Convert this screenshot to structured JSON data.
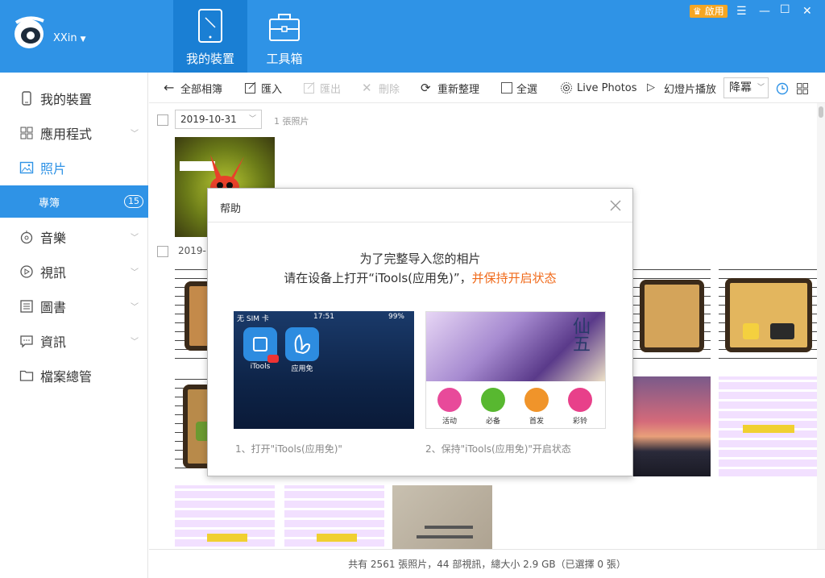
{
  "app": {
    "user": "XXin",
    "vip_label": "啟用"
  },
  "nav_tabs": [
    {
      "label": "我的裝置"
    },
    {
      "label": "工具箱"
    }
  ],
  "sidebar": {
    "items": [
      {
        "label": "我的裝置",
        "icon": "phone-icon"
      },
      {
        "label": "應用程式",
        "icon": "apps-icon"
      },
      {
        "label": "照片",
        "icon": "photo-icon"
      },
      {
        "label": "音樂",
        "icon": "music-icon"
      },
      {
        "label": "視訊",
        "icon": "video-icon"
      },
      {
        "label": "圖書",
        "icon": "book-icon"
      },
      {
        "label": "資訊",
        "icon": "message-icon"
      },
      {
        "label": "檔案總管",
        "icon": "folder-icon"
      }
    ],
    "sub_item": {
      "label": "專簿",
      "badge": "15"
    }
  },
  "toolbar": {
    "all_albums": "全部相簿",
    "import": "匯入",
    "export": "匯出",
    "delete": "刪除",
    "reorganize": "重新整理",
    "select_all": "全選",
    "live_photos": "Live Photos",
    "slideshow": "幻燈片播放",
    "sort": "降冪"
  },
  "groups": [
    {
      "date": "2019-10-31",
      "count": "1 張照片"
    },
    {
      "date": "2019-1"
    }
  ],
  "status": "共有 2561 張照片，44 部視訊，總大小 2.9 GB（已選擇 0 張）",
  "dialog": {
    "title": "帮助",
    "line1": "为了完整导入您的相片",
    "line2_a": "请在设备上打开“iTools(应用免)”，",
    "line2_b": "并保持开启状态",
    "phone": {
      "carrier": "无 SIM 卡",
      "time": "17:51",
      "battery": "99%",
      "app1": "iTools",
      "app2": "应用免"
    },
    "app_tabs": [
      "活动",
      "必备",
      "首发",
      "彩铃"
    ],
    "caption1": "1、打开\"iTools(应用免)\"",
    "caption2": "2、保持\"iTools(应用免)\"开启状态"
  },
  "colors": {
    "accent": "#2f93e6",
    "highlight": "#f06a1a"
  }
}
